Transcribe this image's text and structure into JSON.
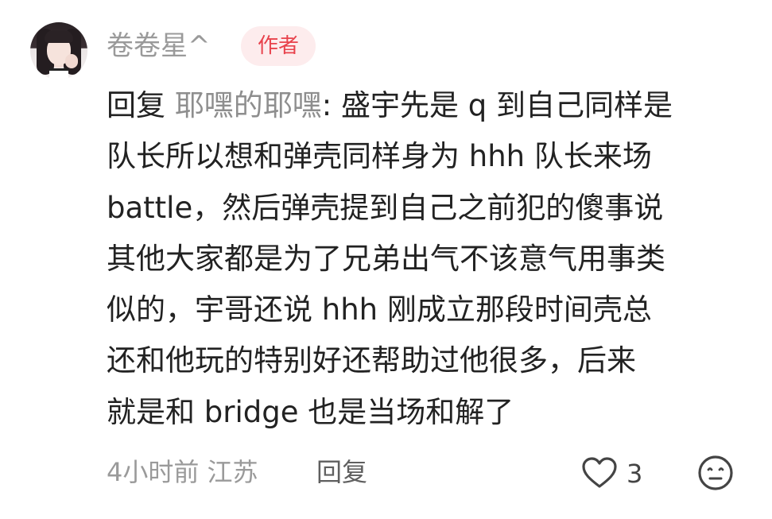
{
  "comment": {
    "username": "卷卷星^",
    "badge": "作者",
    "reply_prefix": "回复 ",
    "mention": "耶嘿的耶嘿",
    "lines": [
      ": 盛宇先是 q 到自己同样是",
      "队长所以想和弹壳同样身为 hhh 队长来场",
      " battle，然后弹壳提到自己之前犯的傻事说",
      "其他大家都是为了兄弟出气不该意气用事类",
      "似的，宇哥还说 hhh 刚成立那段时间壳总",
      "还和他玩的特别好还帮助过他很多，后来",
      "就是和 bridge 也是当场和解了"
    ],
    "time_location": "4小时前 江苏",
    "reply_label": "回复",
    "like_count": "3",
    "icons": {
      "like": "heart-outline-icon",
      "react": "neutral-face-icon"
    },
    "colors": {
      "badge_text": "#e8424c",
      "badge_bg": "#fdeced",
      "muted": "#9a9a9a",
      "text": "#222222"
    }
  }
}
